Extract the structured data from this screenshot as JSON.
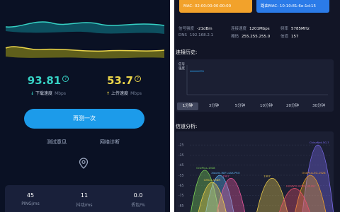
{
  "speedtest": {
    "download": {
      "value": "93.81",
      "info_glyph": "?",
      "arrow": "↓",
      "label": "下载速度",
      "unit": "Mbps",
      "color": "#36d1c4"
    },
    "upload": {
      "value": "53.7",
      "info_glyph": "?",
      "arrow": "↑",
      "label": "上传速度",
      "unit": "Mbps",
      "color": "#ecd64a"
    },
    "retest_label": "再测一次",
    "links": [
      "测试意见",
      "网络诊断"
    ],
    "stats": [
      {
        "value": "45",
        "label": "PING/ms"
      },
      {
        "value": "11",
        "label": "抖动/ms"
      },
      {
        "value": "0.0",
        "label": "丢包/%"
      }
    ]
  },
  "wifi_info": {
    "mac_cards": [
      {
        "text": "MAC: 02:00:00:00:00:00",
        "color": "#f2a22b"
      },
      {
        "text": "路由MAC: 10:10:81:6e:1d:15",
        "color": "#2b7be8"
      }
    ],
    "rows": [
      [
        {
          "k": "信号强度",
          "v": "-21dBm"
        },
        {
          "k": "连接速度",
          "v": "1201Mbps"
        },
        {
          "k": "频率",
          "v": "5785MHz"
        }
      ],
      [
        {
          "k": "DNS",
          "v": "192.168.2.1"
        },
        {
          "k": "掩码",
          "v": "255.255.255.0"
        },
        {
          "k": "信道",
          "v": "157"
        }
      ]
    ]
  },
  "history": {
    "title": "连接历史:",
    "chart_label": "信号\n强度",
    "tabs": [
      "1分钟",
      "3分钟",
      "5分钟",
      "10分钟",
      "20分钟",
      "30分钟"
    ],
    "selected_tab": 0
  },
  "channels": {
    "title": "信道分析:",
    "y_ticks": [
      "-25",
      "-35",
      "-45",
      "-55",
      "-65",
      "-75",
      "-85"
    ]
  },
  "chart_data": [
    {
      "type": "line",
      "title": "连接历史:",
      "ylabel": "信号强度",
      "series": [
        {
          "values": [
            -21,
            -21,
            -21,
            -21,
            -20,
            -21
          ]
        }
      ]
    },
    {
      "type": "area",
      "title": "信道分析:",
      "ylim": [
        -90,
        -20
      ],
      "y_ticks": [
        -25,
        -35,
        -45,
        -55,
        -65,
        -75,
        -85
      ],
      "networks": [
        {
          "name": "ChinaNet-5G-?",
          "center": 157,
          "level": -25,
          "color": "#7d6cf0"
        },
        {
          "name": "OnePlus-1928",
          "center": 36,
          "level": -50,
          "color": "#7ed957"
        },
        {
          "name": "OnePlus-5G-1928",
          "center": 149,
          "level": -55,
          "color": "#f2a22b"
        },
        {
          "name": "Xiaomi-WIFI-4AX-PRO",
          "center": 52,
          "level": -55,
          "color": "#5fb7f5"
        },
        {
          "name": "1907",
          "center": 64,
          "level": -58,
          "color": "#f25aa0"
        },
        {
          "name": "CMCC-3HNR",
          "center": 44,
          "level": -62,
          "color": "#f2d14a"
        },
        {
          "name": "1907",
          "center": 108,
          "level": -58,
          "color": "#f2d14a"
        },
        {
          "name": "HUAWEI-H2BR_HiLink",
          "center": 132,
          "level": -68,
          "color": "#e8506a"
        }
      ]
    }
  ]
}
